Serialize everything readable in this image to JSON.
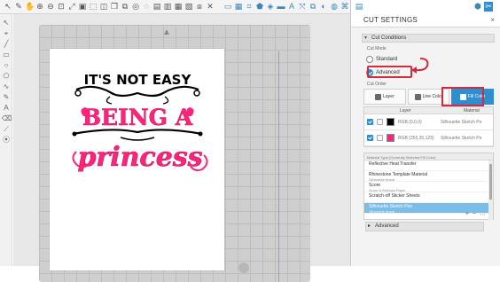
{
  "toolbar": {
    "left_icons": [
      "pointer-icon",
      "zoom-icon",
      "pan-icon",
      "zoom-in-icon",
      "zoom-out-icon",
      "zoom-fit-icon",
      "rotate-icon",
      "select-icon",
      "copy-icon",
      "delete-icon",
      "send-icon"
    ],
    "right_icons": [
      "page-icon",
      "grid-icon",
      "registration-icon",
      "pen-icon",
      "fill-icon",
      "line-icon",
      "shape-icon",
      "transform-icon",
      "replicate-icon",
      "offset-icon",
      "trace-icon",
      "design-icon",
      "library-icon",
      "send-cut-icon"
    ]
  },
  "panel": {
    "title": "CUT SETTINGS",
    "close": "×",
    "cut_conditions_label": "Cut Conditions",
    "cut_mode_label": "Cut Mode",
    "radio_standard": "Standard",
    "radio_advanced": "Advanced",
    "cut_order_label": "Cut Order",
    "order_buttons": [
      "Layer",
      "Line Color",
      "Fill Color"
    ],
    "table_headers": {
      "layer": "Layer",
      "material": "Material"
    },
    "layers": [
      {
        "label": "RGB (0,0,0)",
        "material": "Silhouette Sketch Pe",
        "color": "#000000"
      },
      {
        "label": "RGB (255,35,123)",
        "material": "Silhouette Sketch Pe",
        "color": "#ff237b"
      }
    ],
    "material_header": "Material Type (Currently Selected Fill Color)",
    "materials": [
      {
        "name": "Reflective Heat Transfer",
        "sub": ""
      },
      {
        "name": "Rhinestone Template Material",
        "sub": "Silhouette brand"
      },
      {
        "name": "Score",
        "sub": "Score & Emboss Paper"
      },
      {
        "name": "Scratch-off Sticker Sheets",
        "sub": ""
      },
      {
        "name": "Silhouette Sketch Pen",
        "sub": "Silhouette brand"
      }
    ],
    "material_controls": [
      "+",
      "−",
      "⋯"
    ],
    "advanced_label": "Advanced"
  },
  "design": {
    "line1": "IT'S NOT EASY",
    "line2": "BEING A",
    "line3": "princess"
  },
  "colors": {
    "accent": "#2e8ecf",
    "highlight": "#d22b3c",
    "pink": "#ff237b",
    "black": "#000000"
  }
}
